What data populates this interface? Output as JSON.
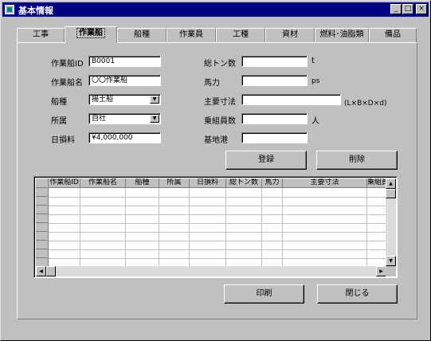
{
  "window": {
    "title": "基本情報",
    "minimize": "_",
    "maximize": "□",
    "close": "×"
  },
  "tabs": [
    {
      "label": "工事"
    },
    {
      "label": "作業船"
    },
    {
      "label": "船種"
    },
    {
      "label": "作業員"
    },
    {
      "label": "工種"
    },
    {
      "label": "資材"
    },
    {
      "label": "燃料･油脂類"
    },
    {
      "label": "備品"
    }
  ],
  "form": {
    "boat_id": {
      "label": "作業船ID",
      "value": "B0001"
    },
    "boat_name": {
      "label": "作業船名",
      "value": "〇〇作業船"
    },
    "boat_type": {
      "label": "船種",
      "value": "揚土船"
    },
    "affiliation": {
      "label": "所属",
      "value": "自社"
    },
    "daily_rate": {
      "label": "日損料",
      "value": "¥4,000,000"
    },
    "tonnage": {
      "label": "総トン数",
      "value": "",
      "unit": "t"
    },
    "horsepower": {
      "label": "馬力",
      "value": "",
      "unit": "ps"
    },
    "dimensions": {
      "label": "主要寸法",
      "value": "",
      "unit": "(L×B×D×d)"
    },
    "crew": {
      "label": "乗組員数",
      "value": "",
      "unit": "人"
    },
    "base_port": {
      "label": "基地港",
      "value": ""
    }
  },
  "buttons": {
    "register": "登録",
    "delete": "削除",
    "print": "印刷",
    "close": "閉じる"
  },
  "grid": {
    "columns": [
      "作業船ID",
      "作業船名",
      "船種",
      "所属",
      "日損料",
      "総トン数",
      "馬力",
      "主要寸法",
      "乗組員"
    ]
  },
  "icons": {
    "combo": "dropdown-arrow-icon",
    "scroll_up": "scroll-up-icon",
    "scroll_down": "scroll-down-icon",
    "scroll_left": "scroll-left-icon",
    "scroll_right": "scroll-right-icon"
  }
}
